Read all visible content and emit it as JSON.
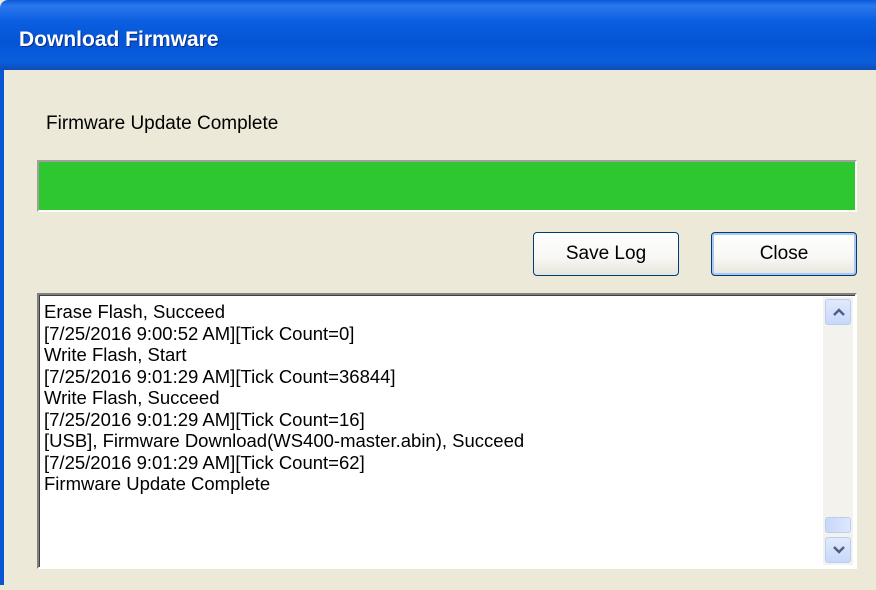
{
  "window": {
    "title": "Download Firmware"
  },
  "status": {
    "text": "Firmware Update Complete",
    "progress_percent": 100,
    "progress_color": "#2fc72f"
  },
  "buttons": {
    "save_log": "Save Log",
    "close": "Close"
  },
  "log": {
    "lines": [
      "Erase Flash, Succeed",
      "[7/25/2016 9:00:52 AM][Tick Count=0]",
      "Write Flash, Start",
      "[7/25/2016 9:01:29 AM][Tick Count=36844]",
      "Write Flash, Succeed",
      "[7/25/2016 9:01:29 AM][Tick Count=16]",
      "[USB], Firmware Download(WS400-master.abin), Succeed",
      "[7/25/2016 9:01:29 AM][Tick Count=62]",
      "Firmware Update Complete"
    ],
    "scroll_up_icon": "chevron-up-icon",
    "scroll_down_icon": "chevron-down-icon"
  },
  "colors": {
    "titlebar": "#0554d6",
    "dialog_bg": "#ece9d8",
    "progress_fill": "#2fc72f"
  }
}
